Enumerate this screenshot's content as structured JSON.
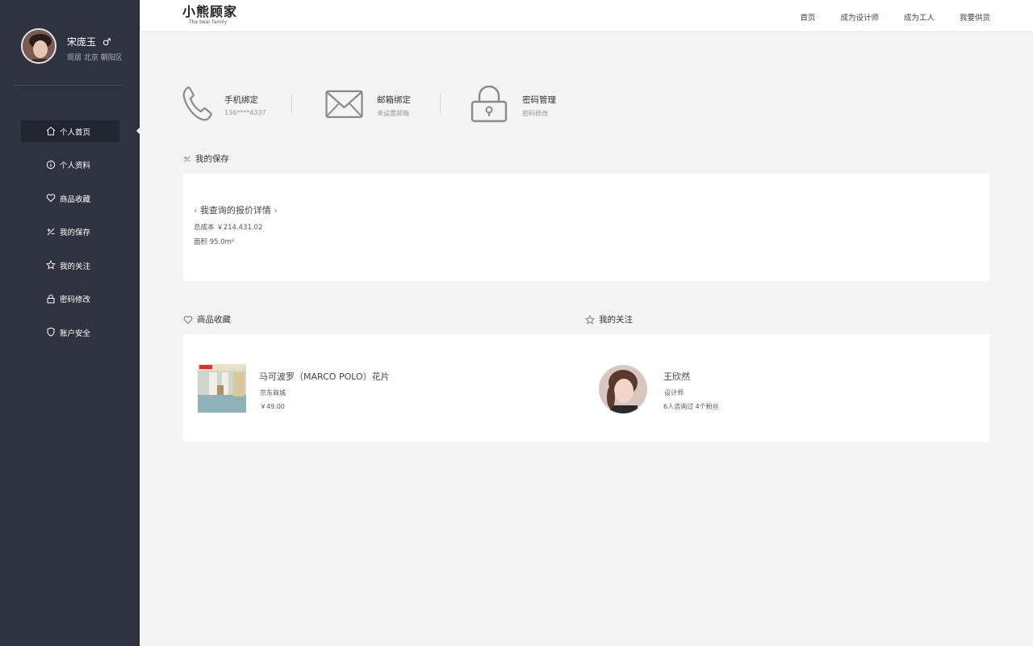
{
  "sidebar": {
    "user": {
      "name": "宋庞玉",
      "gender_symbol": "♂",
      "location": "现居 北京 朝阳区"
    },
    "items": [
      {
        "label": "个人首页",
        "icon": "home-icon",
        "active": true
      },
      {
        "label": "个人资料",
        "icon": "info-icon",
        "active": false
      },
      {
        "label": "商品收藏",
        "icon": "heart-icon",
        "active": false
      },
      {
        "label": "我的保存",
        "icon": "percent-icon",
        "active": false
      },
      {
        "label": "我的关注",
        "icon": "star-icon",
        "active": false
      },
      {
        "label": "密码修改",
        "icon": "lock-icon",
        "active": false
      },
      {
        "label": "账户安全",
        "icon": "shield-icon",
        "active": false
      }
    ]
  },
  "header": {
    "logo_main": "小熊顾家",
    "logo_sub": "The bear family",
    "nav": [
      "首页",
      "成为设计师",
      "成为工人",
      "我要供货"
    ]
  },
  "bindings": {
    "phone": {
      "title": "手机绑定",
      "sub": "136****4337",
      "icon": "phone-icon"
    },
    "email": {
      "title": "邮箱绑定",
      "sub": "未设置邮箱",
      "icon": "envelope-icon"
    },
    "password": {
      "title": "密码管理",
      "sub": "密码修改",
      "icon": "padlock-icon"
    }
  },
  "saved": {
    "section_title": "我的保存",
    "quote_title": "我查询的报价详情",
    "total_cost": "总成本 ￥214,431.02",
    "area": "面积  95.0m²"
  },
  "favorites": {
    "section_title": "商品收藏",
    "product_name": "马可波罗（MARCO POLO）花片",
    "shop": "京东商城",
    "price": "￥49.00"
  },
  "follows": {
    "section_title": "我的关注",
    "designer_name": "王欣然",
    "role": "设计师",
    "stats": "6人咨询过  4个粉丝"
  }
}
